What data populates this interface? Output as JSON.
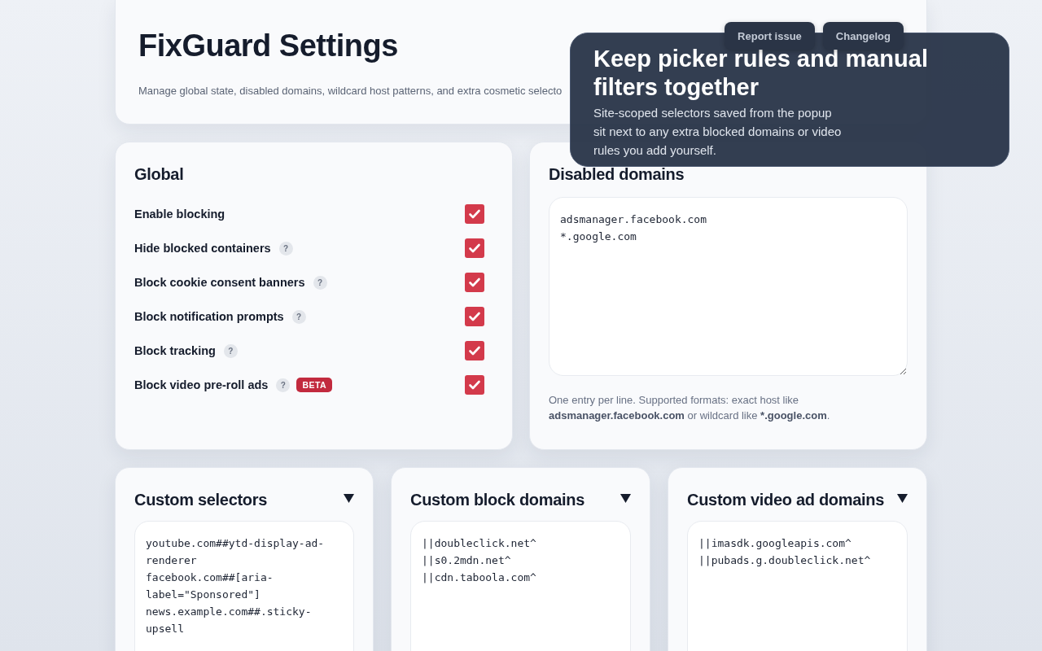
{
  "header": {
    "title": "FixGuard Settings",
    "subtitle": "Manage global state, disabled domains, wildcard host patterns, and extra cosmetic selecto",
    "buttons": [
      "Report issue",
      "Changelog"
    ]
  },
  "tooltip": {
    "title": "Keep picker rules and manual filters together",
    "body": "Site-scoped selectors saved from the popup sit next to any extra blocked domains or video rules you add yourself."
  },
  "global": {
    "title": "Global",
    "options": [
      {
        "label": "Enable blocking",
        "checked": true
      },
      {
        "label": "Hide blocked containers",
        "hint": "?",
        "checked": true
      },
      {
        "label": "Block cookie consent banners",
        "hint": "?",
        "checked": true
      },
      {
        "label": "Block notification prompts",
        "hint": "?",
        "checked": true
      },
      {
        "label": "Block tracking",
        "hint": "?",
        "checked": true
      },
      {
        "label": "Block video pre-roll ads",
        "hint": "?",
        "badge": "BETA",
        "checked": true
      }
    ]
  },
  "disabled_domains": {
    "title": "Disabled domains",
    "value": [
      "adsmanager.facebook.com",
      "*.google.com"
    ],
    "help": "One entry per line. Supported formats: exact host like **adsmanager.facebook.com** or wildcard like ***.google.com**."
  },
  "sections": [
    {
      "title": "Custom selectors",
      "expanded": true,
      "value": [
        "youtube.com##ytd-display-ad-renderer",
        "facebook.com##[aria-label=\"Sponsored\"]",
        "news.example.com##.sticky-upsell"
      ]
    },
    {
      "title": "Custom block domains",
      "expanded": true,
      "value": [
        "||doubleclick.net^",
        "||s0.2mdn.net^",
        "||cdn.taboola.com^"
      ]
    },
    {
      "title": "Custom video ad domains",
      "expanded": true,
      "value": [
        "||imasdk.googleapis.com^",
        "||pubads.g.doubleclick.net^"
      ]
    }
  ]
}
